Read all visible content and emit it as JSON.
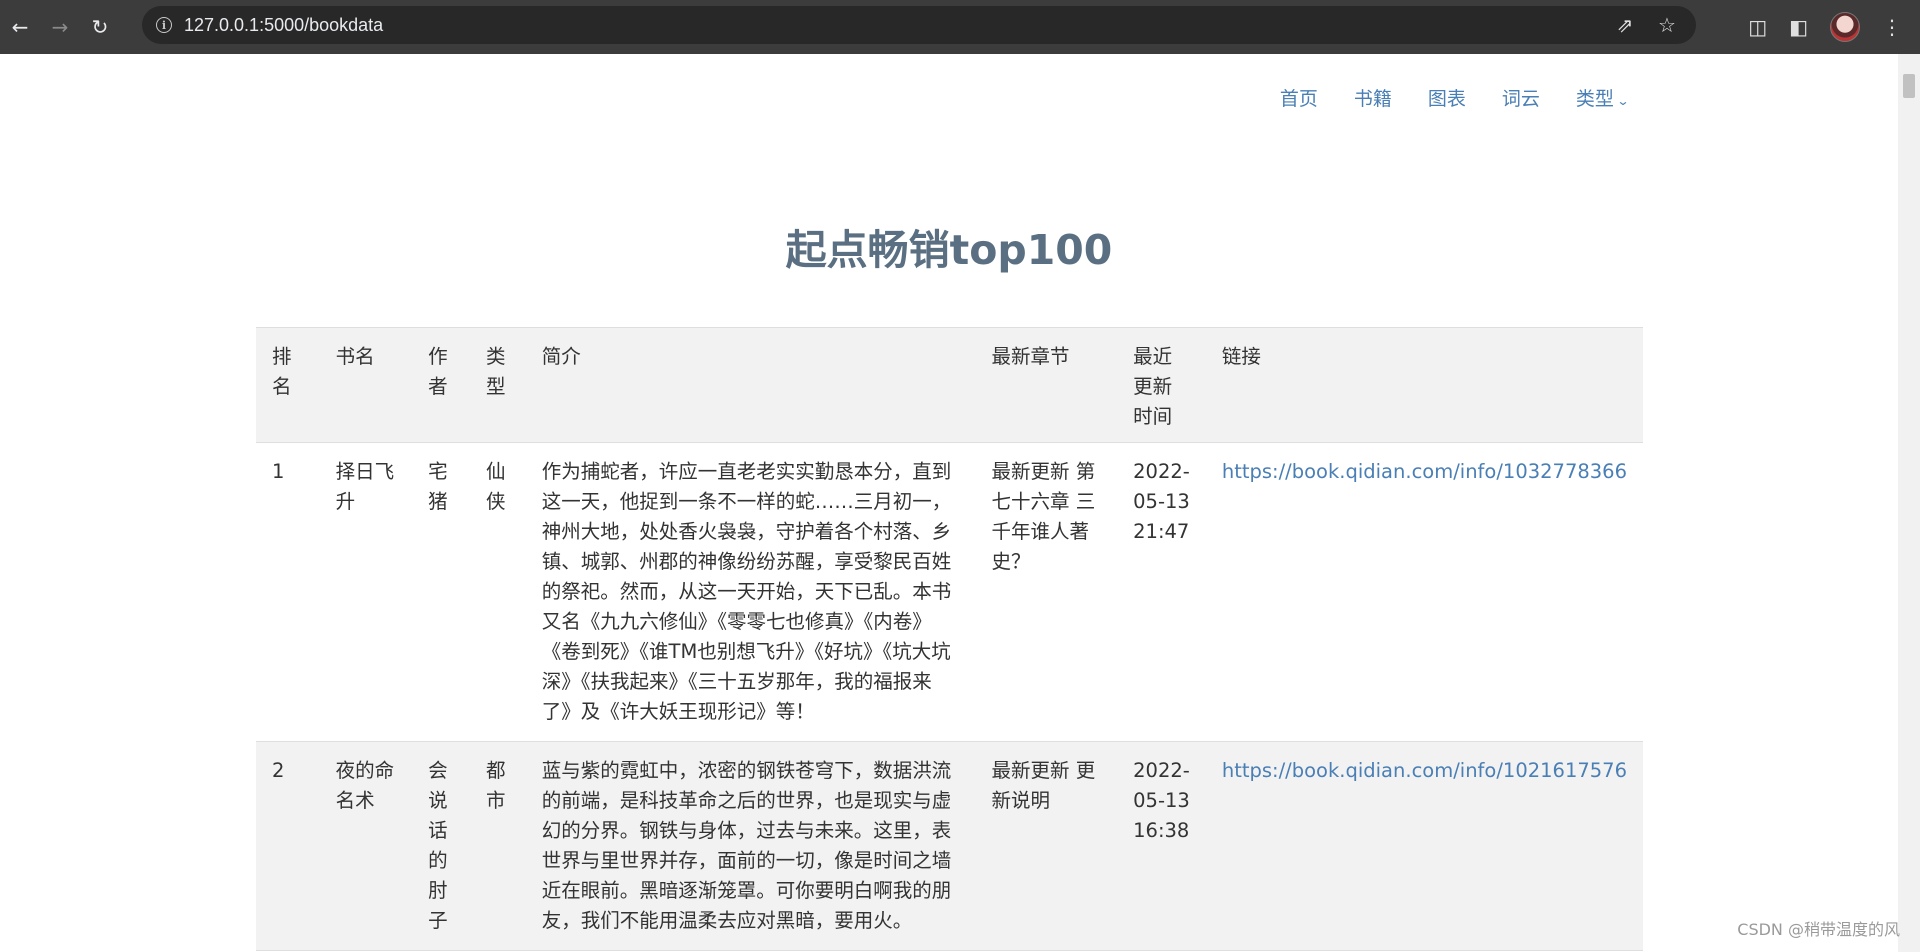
{
  "browser": {
    "url": "127.0.0.1:5000/bookdata"
  },
  "nav": {
    "items": [
      "首页",
      "书籍",
      "图表",
      "词云",
      "类型"
    ]
  },
  "page_title": "起点畅销top100",
  "table": {
    "headers": [
      "排名",
      "书名",
      "作者",
      "类型",
      "简介",
      "最新章节",
      "最近更新时间",
      "链接"
    ],
    "rows": [
      {
        "rank": "1",
        "name": "择日飞升",
        "author": "宅猪",
        "genre": "仙侠",
        "intro": "作为捕蛇者，许应一直老老实实勤恳本分，直到这一天，他捉到一条不一样的蛇……三月初一，神州大地，处处香火袅袅，守护着各个村落、乡镇、城郭、州郡的神像纷纷苏醒，享受黎民百姓的祭祀。然而，从这一天开始，天下已乱。本书又名《九九六修仙》《零零七也修真》《内卷》《卷到死》《谁TM也别想飞升》《好坑》《坑大坑深》《扶我起来》《三十五岁那年，我的福报来了》及《许大妖王现形记》等！",
        "latest": "最新更新 第七十六章 三千年谁人著史？",
        "time": "2022-05-13 21:47",
        "link": "https://book.qidian.com/info/1032778366"
      },
      {
        "rank": "2",
        "name": "夜的命名术",
        "author": "会说话的肘子",
        "genre": "都市",
        "intro": "蓝与紫的霓虹中，浓密的钢铁苍穹下，数据洪流的前端，是科技革命之后的世界，也是现实与虚幻的分界。钢铁与身体，过去与未来。这里，表世界与里世界并存，面前的一切，像是时间之墙近在眼前。黑暗逐渐笼罩。可你要明白啊我的朋友，我们不能用温柔去应对黑暗，要用火。",
        "latest": "最新更新 更新说明",
        "time": "2022-05-13 16:38",
        "link": "https://book.qidian.com/info/1021617576"
      }
    ]
  },
  "watermark": "CSDN @稍带温度的风"
}
